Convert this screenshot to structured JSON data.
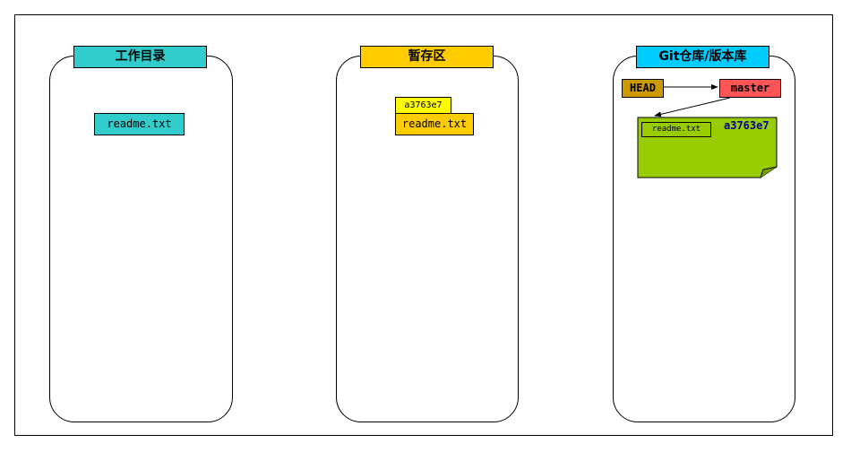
{
  "sections": [
    {
      "title": "工作目录",
      "files": [
        "readme.txt"
      ]
    },
    {
      "title": "暂存区",
      "files": [
        "readme.txt"
      ],
      "hash": "a3763e7"
    },
    {
      "title": "Git仓库/版本库",
      "head": "HEAD",
      "branch": "master",
      "commit": {
        "hash": "a3763e7",
        "files": [
          "readme.txt"
        ]
      }
    }
  ],
  "colors": {
    "working_dir": "#33CCCC",
    "staging": "#FFCC00",
    "repo_title": "#00CCFF",
    "hash_tag": "#FFFF00",
    "head": "#CC9900",
    "branch": "#FF5555",
    "commit": "#99CC00",
    "commit_hash_text": "#000099"
  }
}
